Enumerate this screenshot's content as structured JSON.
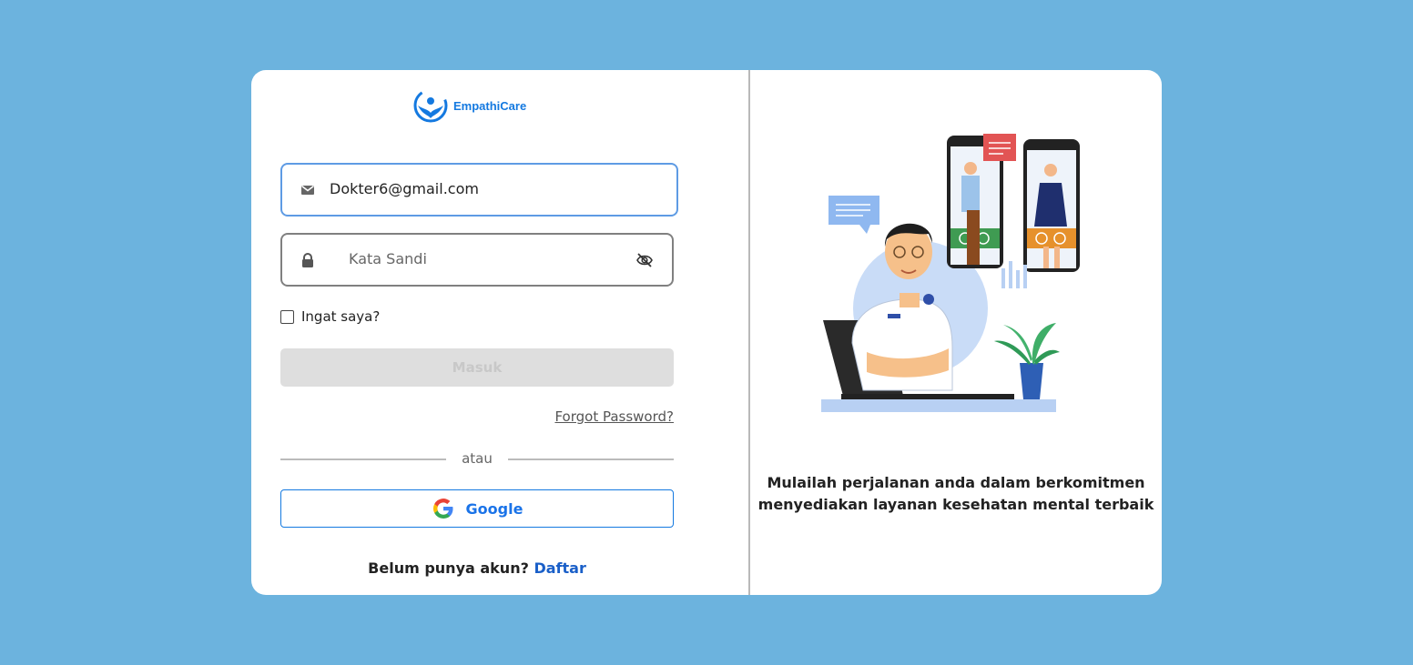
{
  "brand": {
    "name": "EmpathiCare",
    "color": "#1479e0"
  },
  "login": {
    "email": {
      "value": "Dokter6@gmail.com",
      "icon": "mail-icon"
    },
    "password": {
      "placeholder": "Kata Sandi",
      "icon": "lock-icon",
      "toggle_icon": "eye-off-icon"
    },
    "remember_label": "Ingat saya?",
    "remember_checked": false,
    "submit_label": "Masuk",
    "forgot_label": "Forgot Password?",
    "separator": "atau",
    "google_label": "Google",
    "signup_prompt": "Belum punya akun?",
    "signup_link": "Daftar"
  },
  "promo": {
    "tagline_line1": "Mulailah perjalanan anda dalam berkomitmen",
    "tagline_line2": "menyediakan layanan kesehatan mental terbaik"
  },
  "colors": {
    "background": "#6cb3de",
    "primary": "#1479e0",
    "disabled_button": "#dedede"
  }
}
